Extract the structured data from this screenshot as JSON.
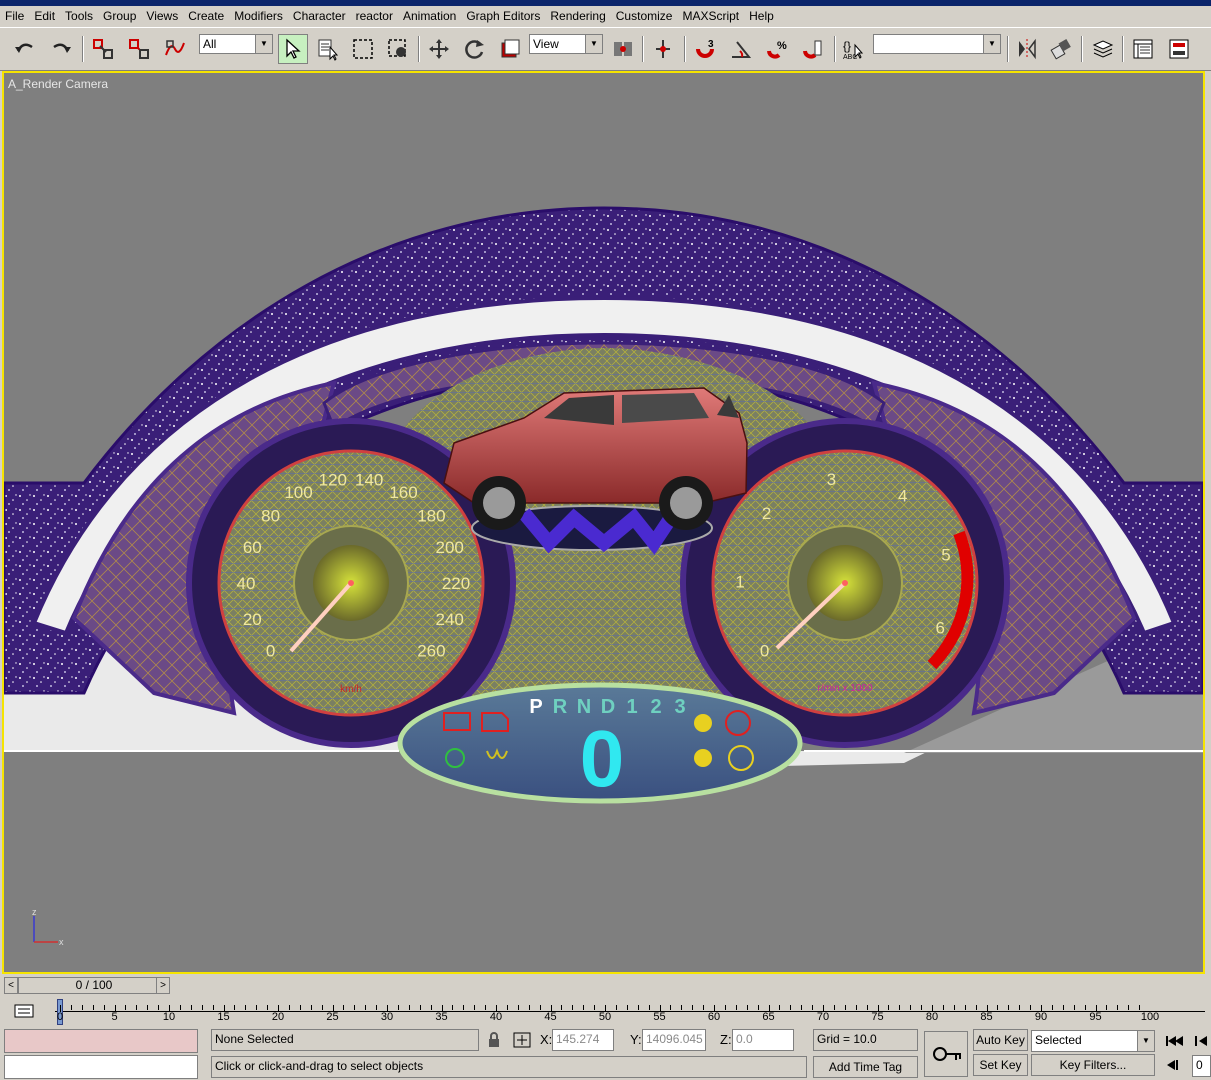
{
  "menu": [
    "File",
    "Edit",
    "Tools",
    "Group",
    "Views",
    "Create",
    "Modifiers",
    "Character",
    "reactor",
    "Animation",
    "Graph Editors",
    "Rendering",
    "Customize",
    "MAXScript",
    "Help"
  ],
  "toolbar": {
    "selection_filter": "All",
    "reference_coord": "View",
    "named_selection": ""
  },
  "viewport": {
    "label": "A_Render Camera",
    "axis_z": "z",
    "axis_x": "x"
  },
  "cluster": {
    "speed_ticks": [
      "0",
      "20",
      "40",
      "60",
      "80",
      "100",
      "120",
      "140",
      "160",
      "180",
      "200",
      "220",
      "240",
      "260"
    ],
    "speed_unit": "km/h",
    "rpm_ticks": [
      "0",
      "1",
      "2",
      "3",
      "4",
      "5",
      "6"
    ],
    "rpm_unit": "r/min x 1000",
    "gear_letters": [
      "P",
      "R",
      "N",
      "D",
      "1",
      "2",
      "3"
    ],
    "digital_speed": "0"
  },
  "timeline": {
    "frame_display": "0 / 100",
    "prev": "<",
    "next": ">",
    "ticks": [
      "0",
      "5",
      "10",
      "15",
      "20",
      "25",
      "30",
      "35",
      "40",
      "45",
      "50",
      "55",
      "60",
      "65",
      "70",
      "75",
      "80",
      "85",
      "90",
      "95",
      "100"
    ]
  },
  "status": {
    "selection": "None Selected",
    "prompt": "Click or click-and-drag to select objects",
    "x_label": "X:",
    "x_value": "145.274",
    "y_label": "Y:",
    "y_value": "14096.045",
    "z_label": "Z:",
    "z_value": "0.0",
    "grid": "Grid = 10.0",
    "add_time_tag": "Add Time Tag",
    "auto_key": "Auto Key",
    "set_key": "Set Key",
    "key_mode": "Selected",
    "key_filters": "Key Filters...",
    "frame_field": "0"
  },
  "colors": {
    "viewport_bg": "#7f7f7f",
    "viewport_border": "#f6e400",
    "ui_face": "#d4d0c8"
  }
}
